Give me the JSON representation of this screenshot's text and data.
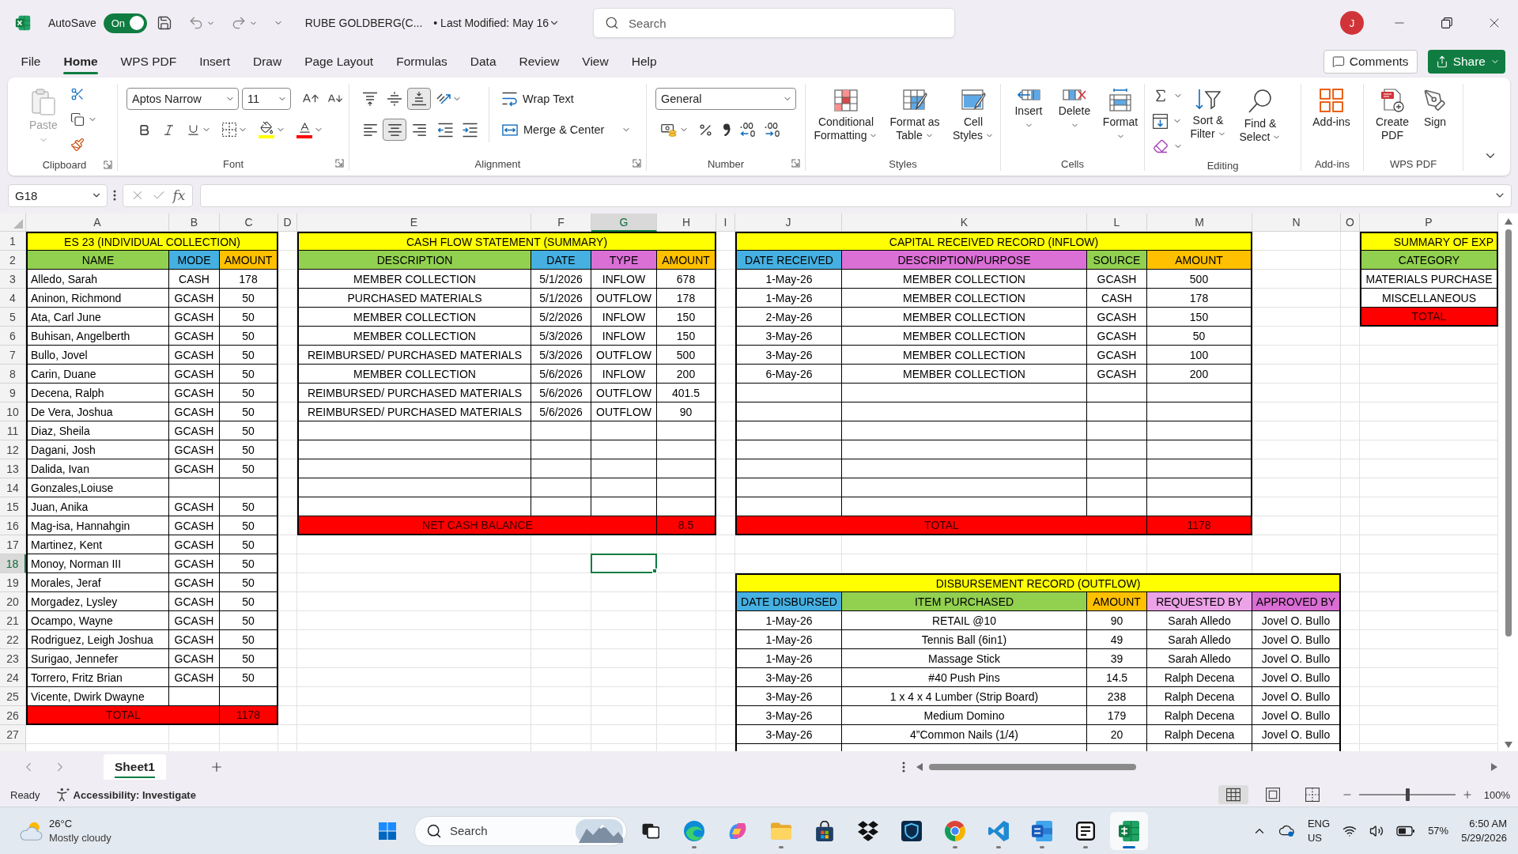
{
  "title_bar": {
    "autosave": {
      "label": "AutoSave",
      "toggle_text": "On",
      "on": true
    },
    "document_name": "RUBE GOLDBERG(C...",
    "last_modified": "• Last Modified: May 16",
    "search": {
      "placeholder": "Search"
    },
    "account_initial": "J"
  },
  "menu_tabs": [
    {
      "label": "File",
      "selected": false
    },
    {
      "label": "Home",
      "selected": true
    },
    {
      "label": "WPS PDF",
      "selected": false
    },
    {
      "label": "Insert",
      "selected": false
    },
    {
      "label": "Draw",
      "selected": false
    },
    {
      "label": "Page Layout",
      "selected": false
    },
    {
      "label": "Formulas",
      "selected": false
    },
    {
      "label": "Data",
      "selected": false
    },
    {
      "label": "Review",
      "selected": false
    },
    {
      "label": "View",
      "selected": false
    },
    {
      "label": "Help",
      "selected": false
    }
  ],
  "comments_button": "Comments",
  "share_button": "Share",
  "ribbon": {
    "clipboard": {
      "label": "Clipboard",
      "paste": {
        "label": "Paste",
        "disabled": true
      }
    },
    "font": {
      "label": "Font",
      "font_name": "Aptos Narrow",
      "font_size": "11"
    },
    "alignment": {
      "label": "Alignment",
      "vertical": [
        {
          "selected": false
        },
        {
          "selected": false
        },
        {
          "selected": true
        }
      ],
      "horizontal": [
        {
          "selected": false
        },
        {
          "selected": true
        },
        {
          "selected": false
        }
      ],
      "wrap_text": "Wrap Text",
      "merge_center": "Merge & Center"
    },
    "number": {
      "label": "Number",
      "format": "General"
    },
    "styles": {
      "label": "Styles",
      "buttons": [
        "Conditional Formatting",
        "Format as Table",
        "Cell Styles"
      ]
    },
    "cells": {
      "label": "Cells",
      "buttons": [
        "Insert",
        "Delete",
        "Format"
      ]
    },
    "editing": {
      "label": "Editing",
      "buttons": [
        "Sort & Filter",
        "Find & Select"
      ]
    },
    "add_ins": {
      "label": "Add-ins",
      "buttons": [
        "Add-ins"
      ]
    },
    "wps_pdf": {
      "label": "WPS PDF",
      "buttons": [
        "Create PDF",
        "Sign"
      ]
    }
  },
  "formula_bar": {
    "name_box": "G18",
    "function_label": "fx"
  },
  "sheet": {
    "column_headers": [
      {
        "label": "A",
        "selected": false
      },
      {
        "label": "B",
        "selected": false
      },
      {
        "label": "C",
        "selected": false
      },
      {
        "label": "D",
        "selected": false
      },
      {
        "label": "E",
        "selected": false
      },
      {
        "label": "F",
        "selected": false
      },
      {
        "label": "G",
        "selected": true
      },
      {
        "label": "H",
        "selected": false
      },
      {
        "label": "I",
        "selected": false
      },
      {
        "label": "J",
        "selected": false
      },
      {
        "label": "K",
        "selected": false
      },
      {
        "label": "L",
        "selected": false
      },
      {
        "label": "M",
        "selected": false
      },
      {
        "label": "N",
        "selected": false
      },
      {
        "label": "O",
        "selected": false
      },
      {
        "label": "P",
        "selected": false
      }
    ],
    "row_headers": [
      {
        "label": "1",
        "selected": false
      },
      {
        "label": "2",
        "selected": false
      },
      {
        "label": "3",
        "selected": false
      },
      {
        "label": "4",
        "selected": false
      },
      {
        "label": "5",
        "selected": false
      },
      {
        "label": "6",
        "selected": false
      },
      {
        "label": "7",
        "selected": false
      },
      {
        "label": "8",
        "selected": false
      },
      {
        "label": "9",
        "selected": false
      },
      {
        "label": "10",
        "selected": false
      },
      {
        "label": "11",
        "selected": false
      },
      {
        "label": "12",
        "selected": false
      },
      {
        "label": "13",
        "selected": false
      },
      {
        "label": "14",
        "selected": false
      },
      {
        "label": "15",
        "selected": false
      },
      {
        "label": "16",
        "selected": false
      },
      {
        "label": "17",
        "selected": false
      },
      {
        "label": "18",
        "selected": true
      },
      {
        "label": "19",
        "selected": false
      },
      {
        "label": "20",
        "selected": false
      },
      {
        "label": "21",
        "selected": false
      },
      {
        "label": "22",
        "selected": false
      },
      {
        "label": "23",
        "selected": false
      },
      {
        "label": "24",
        "selected": false
      },
      {
        "label": "25",
        "selected": false
      },
      {
        "label": "26",
        "selected": false
      },
      {
        "label": "27",
        "selected": false
      }
    ],
    "tables": [
      {
        "title": "ES 23 (INDIVIDUAL COLLECTION)",
        "columns": [
          {
            "label": "NAME",
            "color": "#92d050"
          },
          {
            "label": "MODE",
            "color": "#45b0e1"
          },
          {
            "label": "AMOUNT",
            "color": "#ffc000"
          }
        ],
        "rows": [
          {
            "name": "Alledo, Sarah",
            "mode": "CASH",
            "amount": "178"
          },
          {
            "name": "Aninon, Richmond",
            "mode": "GCASH",
            "amount": "50"
          },
          {
            "name": "Ata, Carl June",
            "mode": "GCASH",
            "amount": "50"
          },
          {
            "name": "Buhisan, Angelberth",
            "mode": "GCASH",
            "amount": "50"
          },
          {
            "name": "Bullo, Jovel",
            "mode": "GCASH",
            "amount": "50"
          },
          {
            "name": "Carin, Duane",
            "mode": "GCASH",
            "amount": "50"
          },
          {
            "name": "Decena, Ralph",
            "mode": "GCASH",
            "amount": "50"
          },
          {
            "name": "De Vera, Joshua",
            "mode": "GCASH",
            "amount": "50"
          },
          {
            "name": "Diaz, Sheila",
            "mode": "GCASH",
            "amount": "50"
          },
          {
            "name": "Dagani, Josh",
            "mode": "GCASH",
            "amount": "50"
          },
          {
            "name": "Dalida, Ivan",
            "mode": "GCASH",
            "amount": "50"
          },
          {
            "name": "Gonzales,Loiuse"
          },
          {
            "name": "Juan, Anika",
            "mode": "GCASH",
            "amount": "50"
          },
          {
            "name": "Mag-isa, Hannahgin",
            "mode": "GCASH",
            "amount": "50"
          },
          {
            "name": "Martinez, Kent",
            "mode": "GCASH",
            "amount": "50"
          },
          {
            "name": "Monoy, Norman III",
            "mode": "GCASH",
            "amount": "50"
          },
          {
            "name": "Morales, Jeraf",
            "mode": "GCASH",
            "amount": "50"
          },
          {
            "name": "Morgadez, Lysley",
            "mode": "GCASH",
            "amount": "50"
          },
          {
            "name": "Ocampo, Wayne",
            "mode": "GCASH",
            "amount": "50"
          },
          {
            "name": "Rodriguez, Leigh Joshua",
            "mode": "GCASH",
            "amount": "50"
          },
          {
            "name": "Surigao, Jennefer",
            "mode": "GCASH",
            "amount": "50"
          },
          {
            "name": "Torrero, Fritz Brian",
            "mode": "GCASH",
            "amount": "50"
          },
          {
            "name": "Vicente, Dwirk Dwayne"
          }
        ],
        "total": {
          "label": "TOTAL",
          "value": "1178"
        }
      },
      {
        "title": "CASH FLOW STATEMENT (SUMMARY)",
        "columns": [
          {
            "label": "DESCRIPTION",
            "color": "#92d050"
          },
          {
            "label": "DATE",
            "color": "#45b0e1"
          },
          {
            "label": "TYPE",
            "color": "#da70d6"
          },
          {
            "label": "AMOUNT",
            "color": "#ffc000"
          }
        ],
        "rows": [
          {
            "description": "MEMBER COLLECTION",
            "date": "5/1/2026",
            "type": "INFLOW",
            "amount": "678"
          },
          {
            "description": "PURCHASED MATERIALS",
            "date": "5/1/2026",
            "type": "OUTFLOW",
            "amount": "178"
          },
          {
            "description": "MEMBER COLLECTION",
            "date": "5/2/2026",
            "type": "INFLOW",
            "amount": "150"
          },
          {
            "description": "MEMBER COLLECTION",
            "date": "5/3/2026",
            "type": "INFLOW",
            "amount": "150"
          },
          {
            "description": "REIMBURSED/ PURCHASED MATERIALS",
            "date": "5/3/2026",
            "type": "OUTFLOW",
            "amount": "500"
          },
          {
            "description": "MEMBER COLLECTION",
            "date": "5/6/2026",
            "type": "INFLOW",
            "amount": "200"
          },
          {
            "description": "REIMBURSED/ PURCHASED MATERIALS",
            "date": "5/6/2026",
            "type": "OUTFLOW",
            "amount": "401.5"
          },
          {
            "description": "REIMBURSED/ PURCHASED MATERIALS",
            "date": "5/6/2026",
            "type": "OUTFLOW",
            "amount": "90"
          }
        ],
        "total": {
          "label": "NET CASH BALANCE",
          "value": "8.5"
        }
      },
      {
        "title": "CAPITAL RECEIVED RECORD (INFLOW)",
        "columns": [
          {
            "label": "DATE RECEIVED",
            "color": "#45b0e1"
          },
          {
            "label": "DESCRIPTION/PURPOSE",
            "color": "#da70d6"
          },
          {
            "label": "SOURCE",
            "color": "#92d050"
          },
          {
            "label": "AMOUNT",
            "color": "#ffc000"
          }
        ],
        "rows": [
          {
            "date_received": "1-May-26",
            "description": "MEMBER COLLECTION",
            "source": "GCASH",
            "amount": "500"
          },
          {
            "date_received": "1-May-26",
            "description": "MEMBER COLLECTION",
            "source": "CASH",
            "amount": "178"
          },
          {
            "date_received": "2-May-26",
            "description": "MEMBER COLLECTION",
            "source": "GCASH",
            "amount": "150"
          },
          {
            "date_received": "3-May-26",
            "description": "MEMBER COLLECTION",
            "source": "GCASH",
            "amount": "50"
          },
          {
            "date_received": "3-May-26",
            "description": "MEMBER COLLECTION",
            "source": "GCASH",
            "amount": "100"
          },
          {
            "date_received": "6-May-26",
            "description": "MEMBER COLLECTION",
            "source": "GCASH",
            "amount": "200"
          }
        ],
        "total": {
          "label": "TOTAL",
          "value": "1178"
        }
      },
      {
        "title": "SUMMARY OF EXP",
        "columns": [
          {
            "label": "CATEGORY",
            "color": "#92d050"
          }
        ],
        "rows": [
          {
            "category": "MATERIALS PURCHASE"
          },
          {
            "category": "MISCELLANEOUS"
          }
        ],
        "total": {
          "label": "TOTAL"
        }
      },
      {
        "title": "DISBURSEMENT RECORD (OUTFLOW)",
        "columns": [
          {
            "label": "DATE DISBURSED",
            "color": "#45b0e1"
          },
          {
            "label": "ITEM PURCHASED",
            "color": "#92d050"
          },
          {
            "label": "AMOUNT",
            "color": "#ffc000"
          },
          {
            "label": "REQUESTED BY",
            "color": "#eba2e6"
          },
          {
            "label": "APPROVED BY",
            "color": "#d86dd3"
          }
        ],
        "rows": [
          {
            "date": "1-May-26",
            "item": "RETAIL @10",
            "amount": "90",
            "requested_by": "Sarah Alledo",
            "approved_by": "Jovel O. Bullo"
          },
          {
            "date": "1-May-26",
            "item": "Tennis Ball (6in1)",
            "amount": "49",
            "requested_by": "Sarah Alledo",
            "approved_by": "Jovel O. Bullo"
          },
          {
            "date": "1-May-26",
            "item": "Massage Stick",
            "amount": "39",
            "requested_by": "Sarah Alledo",
            "approved_by": "Jovel O. Bullo"
          },
          {
            "date": "3-May-26",
            "item": "#40 Push Pins",
            "amount": "14.5",
            "requested_by": "Ralph Decena",
            "approved_by": "Jovel O. Bullo"
          },
          {
            "date": "3-May-26",
            "item": "1 x 4 x 4 Lumber (Strip Board)",
            "amount": "238",
            "requested_by": "Ralph Decena",
            "approved_by": "Jovel O. Bullo"
          },
          {
            "date": "3-May-26",
            "item": "Medium Domino",
            "amount": "179",
            "requested_by": "Ralph Decena",
            "approved_by": "Jovel O. Bullo"
          },
          {
            "date": "3-May-26",
            "item": "4”Common Nails (1/4)",
            "amount": "20",
            "requested_by": "Ralph Decena",
            "approved_by": "Jovel O. Bullo"
          }
        ]
      }
    ]
  },
  "sheet_tabs": [
    {
      "label": "Sheet1",
      "selected": true
    }
  ],
  "status_bar": {
    "status": "Ready",
    "accessibility": "Accessibility: Investigate",
    "views": [
      {
        "selected": true
      },
      {
        "selected": false
      },
      {
        "selected": false
      }
    ],
    "zoom": {
      "level": 0.5,
      "reading": "100%"
    }
  },
  "taskbar": {
    "weather": {
      "temperature": "26°C",
      "condition": "Mostly cloudy"
    },
    "search": {
      "placeholder": "Search"
    },
    "apps": [
      {
        "running": false,
        "selected": false
      },
      {
        "running": true,
        "selected": false
      },
      {
        "running": false,
        "selected": false
      },
      {
        "running": true,
        "selected": false
      },
      {
        "running": false,
        "selected": false
      },
      {
        "running": false,
        "selected": false
      },
      {
        "running": false,
        "selected": false
      },
      {
        "running": true,
        "selected": false
      },
      {
        "running": true,
        "selected": false
      },
      {
        "running": true,
        "selected": false
      },
      {
        "running": true,
        "selected": false
      },
      {
        "running": true,
        "selected": true
      }
    ],
    "tray": {
      "language": "ENG",
      "region": "US",
      "battery": "57%",
      "time": "6:50 AM",
      "date": "5/29/2026"
    }
  }
}
